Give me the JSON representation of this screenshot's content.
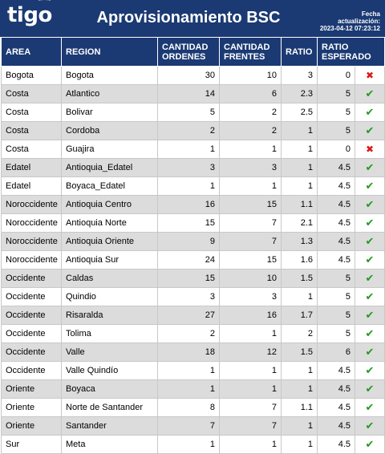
{
  "header": {
    "logo": "tigo",
    "title": "Aprovisionamiento BSC",
    "update_label_1": "Fecha",
    "update_label_2": "actualización:",
    "update_value": "2023-04-12 07:23:12"
  },
  "columns": {
    "area": "AREA",
    "region": "REGION",
    "cantidad_ordenes": [
      "CANTIDAD",
      "ORDENES"
    ],
    "cantidad_frentes": [
      "CANTIDAD",
      "FRENTES"
    ],
    "ratio": "RATIO",
    "ratio_esperado": [
      "RATIO",
      "ESPERADO"
    ]
  },
  "rows": [
    {
      "area": "Bogota",
      "region": "Bogota",
      "ordenes": "30",
      "frentes": "10",
      "ratio": "3",
      "esperado": "0",
      "status": "bad"
    },
    {
      "area": "Costa",
      "region": "Atlantico",
      "ordenes": "14",
      "frentes": "6",
      "ratio": "2.3",
      "esperado": "5",
      "status": "ok"
    },
    {
      "area": "Costa",
      "region": "Bolivar",
      "ordenes": "5",
      "frentes": "2",
      "ratio": "2.5",
      "esperado": "5",
      "status": "ok"
    },
    {
      "area": "Costa",
      "region": "Cordoba",
      "ordenes": "2",
      "frentes": "2",
      "ratio": "1",
      "esperado": "5",
      "status": "ok"
    },
    {
      "area": "Costa",
      "region": "Guajira",
      "ordenes": "1",
      "frentes": "1",
      "ratio": "1",
      "esperado": "0",
      "status": "bad"
    },
    {
      "area": "Edatel",
      "region": "Antioquia_Edatel",
      "ordenes": "3",
      "frentes": "3",
      "ratio": "1",
      "esperado": "4.5",
      "status": "ok"
    },
    {
      "area": "Edatel",
      "region": "Boyaca_Edatel",
      "ordenes": "1",
      "frentes": "1",
      "ratio": "1",
      "esperado": "4.5",
      "status": "ok"
    },
    {
      "area": "Noroccidente",
      "region": "Antioquia Centro",
      "ordenes": "16",
      "frentes": "15",
      "ratio": "1.1",
      "esperado": "4.5",
      "status": "ok"
    },
    {
      "area": "Noroccidente",
      "region": "Antioquia Norte",
      "ordenes": "15",
      "frentes": "7",
      "ratio": "2.1",
      "esperado": "4.5",
      "status": "ok"
    },
    {
      "area": "Noroccidente",
      "region": "Antioquia Oriente",
      "ordenes": "9",
      "frentes": "7",
      "ratio": "1.3",
      "esperado": "4.5",
      "status": "ok"
    },
    {
      "area": "Noroccidente",
      "region": "Antioquia Sur",
      "ordenes": "24",
      "frentes": "15",
      "ratio": "1.6",
      "esperado": "4.5",
      "status": "ok"
    },
    {
      "area": "Occidente",
      "region": "Caldas",
      "ordenes": "15",
      "frentes": "10",
      "ratio": "1.5",
      "esperado": "5",
      "status": "ok"
    },
    {
      "area": "Occidente",
      "region": "Quindio",
      "ordenes": "3",
      "frentes": "3",
      "ratio": "1",
      "esperado": "5",
      "status": "ok"
    },
    {
      "area": "Occidente",
      "region": "Risaralda",
      "ordenes": "27",
      "frentes": "16",
      "ratio": "1.7",
      "esperado": "5",
      "status": "ok"
    },
    {
      "area": "Occidente",
      "region": "Tolima",
      "ordenes": "2",
      "frentes": "1",
      "ratio": "2",
      "esperado": "5",
      "status": "ok"
    },
    {
      "area": "Occidente",
      "region": "Valle",
      "ordenes": "18",
      "frentes": "12",
      "ratio": "1.5",
      "esperado": "6",
      "status": "ok"
    },
    {
      "area": "Occidente",
      "region": "Valle Quindío",
      "ordenes": "1",
      "frentes": "1",
      "ratio": "1",
      "esperado": "4.5",
      "status": "ok"
    },
    {
      "area": "Oriente",
      "region": "Boyaca",
      "ordenes": "1",
      "frentes": "1",
      "ratio": "1",
      "esperado": "4.5",
      "status": "ok"
    },
    {
      "area": "Oriente",
      "region": "Norte de Santander",
      "ordenes": "8",
      "frentes": "7",
      "ratio": "1.1",
      "esperado": "4.5",
      "status": "ok"
    },
    {
      "area": "Oriente",
      "region": "Santander",
      "ordenes": "7",
      "frentes": "7",
      "ratio": "1",
      "esperado": "4.5",
      "status": "ok"
    },
    {
      "area": "Sur",
      "region": "Meta",
      "ordenes": "1",
      "frentes": "1",
      "ratio": "1",
      "esperado": "4.5",
      "status": "ok"
    }
  ],
  "status_icons": {
    "ok": {
      "icon": "check-icon",
      "glyph": "✔",
      "color": "#1f9b1f"
    },
    "bad": {
      "icon": "cross-icon",
      "glyph": "✖",
      "color": "#e01818"
    }
  },
  "colors": {
    "header_bg": "#1b3a73",
    "row_alt": "#dcdcdc"
  }
}
